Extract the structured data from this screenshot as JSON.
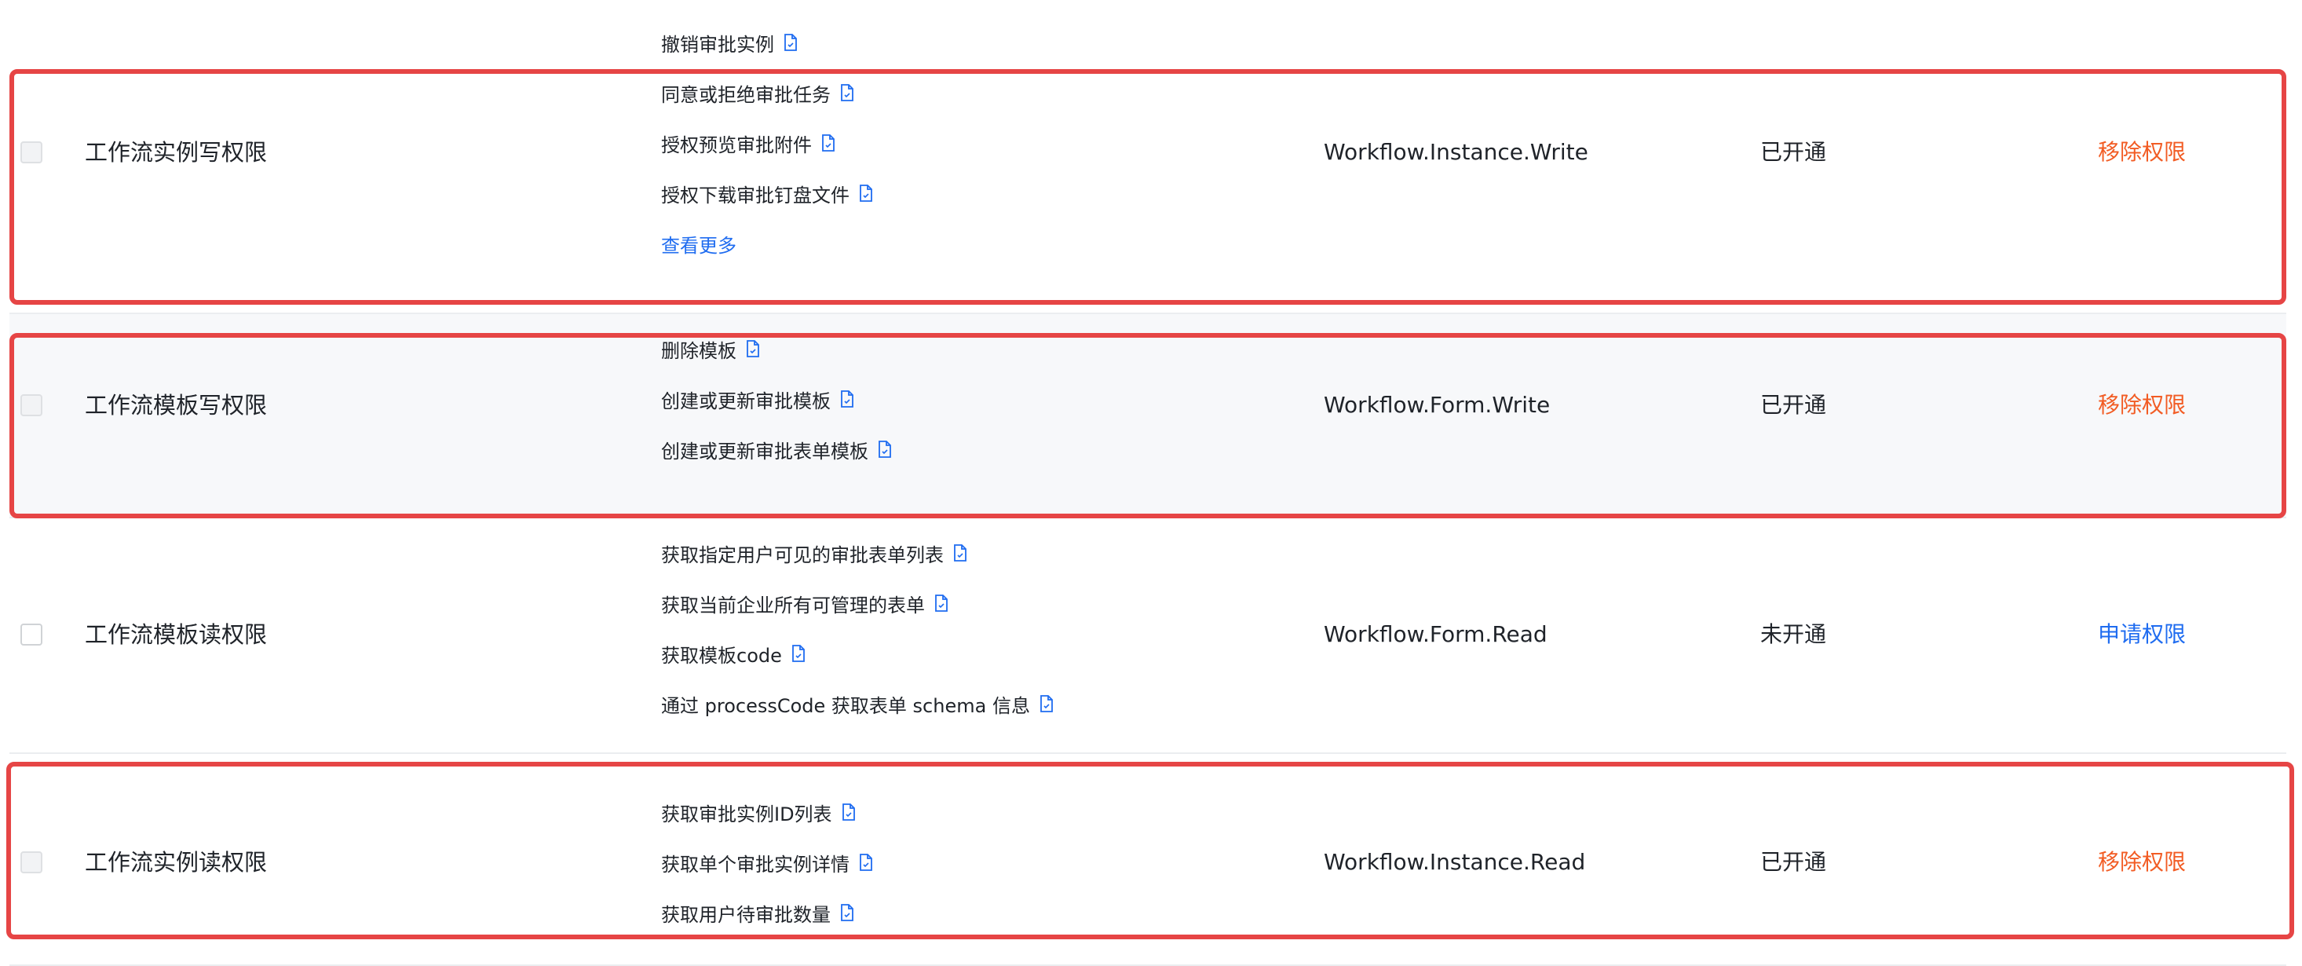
{
  "colors": {
    "highlight": "#e64545",
    "remove_action": "#f25c24",
    "apply_action": "#1f6cf0",
    "shaded_row": "#f7f8fa"
  },
  "icons": {
    "doc": "document-icon"
  },
  "rows": [
    {
      "name": "工作流实例写权限",
      "apis": [
        "撤销审批实例",
        "同意或拒绝审批任务",
        "授权预览审批附件",
        "授权下载审批钉盘文件"
      ],
      "more": "查看更多",
      "scope": "Workflow.Instance.Write",
      "status": "已开通",
      "action": "移除权限"
    },
    {
      "name": "工作流模板写权限",
      "apis": [
        "删除模板",
        "创建或更新审批模板",
        "创建或更新审批表单模板"
      ],
      "scope": "Workflow.Form.Write",
      "status": "已开通",
      "action": "移除权限"
    },
    {
      "name": "工作流模板读权限",
      "apis": [
        "获取指定用户可见的审批表单列表",
        "获取当前企业所有可管理的表单",
        "获取模板code",
        "通过 processCode 获取表单 schema 信息"
      ],
      "scope": "Workflow.Form.Read",
      "status": "未开通",
      "action": "申请权限"
    },
    {
      "name": "工作流实例读权限",
      "apis": [
        "获取审批实例ID列表",
        "获取单个审批实例详情",
        "获取用户待审批数量"
      ],
      "scope": "Workflow.Instance.Read",
      "status": "已开通",
      "action": "移除权限"
    }
  ]
}
